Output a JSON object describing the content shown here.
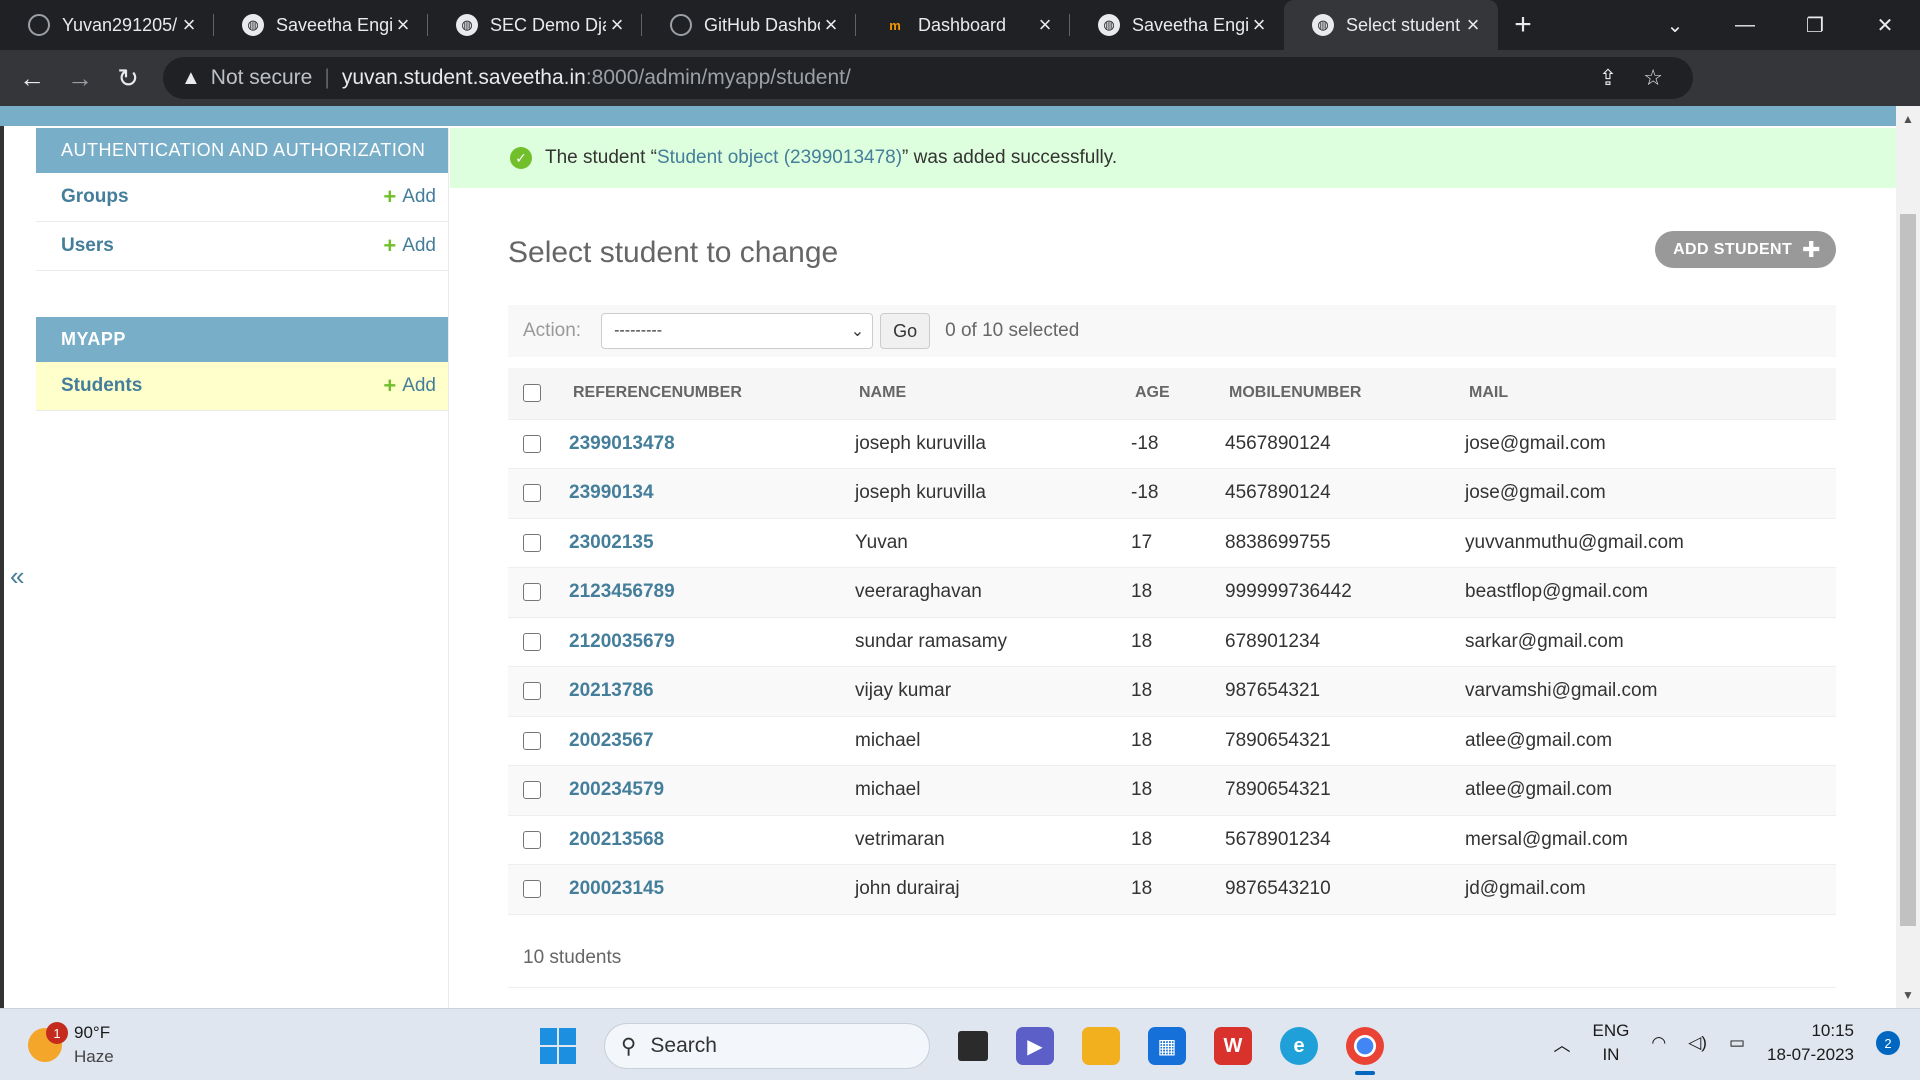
{
  "browser": {
    "tabs": [
      {
        "title": "Yuvan291205/",
        "icon": "github-icon"
      },
      {
        "title": "Saveetha Engin",
        "icon": "globe-icon"
      },
      {
        "title": "SEC Demo Djar",
        "icon": "globe-icon"
      },
      {
        "title": "GitHub Dashbo",
        "icon": "github-icon"
      },
      {
        "title": "Dashboard",
        "icon": "moodle-icon"
      },
      {
        "title": "Saveetha Engin",
        "icon": "globe-icon"
      },
      {
        "title": "Select student",
        "icon": "globe-icon"
      }
    ],
    "security_label": "Not secure",
    "url_host": "yuvan.student.saveetha.in",
    "url_path": ":8000/admin/myapp/student/"
  },
  "sidebar": {
    "auth_caption": "AUTHENTICATION AND AUTHORIZATION",
    "auth_models": [
      {
        "label": "Groups",
        "add": "Add"
      },
      {
        "label": "Users",
        "add": "Add"
      }
    ],
    "app_caption": "MYAPP",
    "app_models": [
      {
        "label": "Students",
        "add": "Add"
      }
    ],
    "collapse_glyph": "«"
  },
  "message": {
    "prefix": "The student “",
    "link": "Student object (2399013478)",
    "suffix": "” was added successfully."
  },
  "changelist": {
    "title": "Select student to change",
    "add_button": "ADD STUDENT",
    "action_label": "Action:",
    "action_selected": "---------",
    "go_label": "Go",
    "selected_counter": "0 of 10 selected",
    "columns": [
      "REFERENCENUMBER",
      "NAME",
      "AGE",
      "MOBILENUMBER",
      "MAIL"
    ],
    "rows": [
      {
        "ref": "2399013478",
        "name": "joseph kuruvilla",
        "age": "-18",
        "mobile": "4567890124",
        "mail": "jose@gmail.com"
      },
      {
        "ref": "23990134",
        "name": "joseph kuruvilla",
        "age": "-18",
        "mobile": "4567890124",
        "mail": "jose@gmail.com"
      },
      {
        "ref": "23002135",
        "name": "Yuvan",
        "age": "17",
        "mobile": "8838699755",
        "mail": "yuvvanmuthu@gmail.com"
      },
      {
        "ref": "2123456789",
        "name": "veeraraghavan",
        "age": "18",
        "mobile": "999999736442",
        "mail": "beastflop@gmail.com"
      },
      {
        "ref": "2120035679",
        "name": "sundar ramasamy",
        "age": "18",
        "mobile": "678901234",
        "mail": "sarkar@gmail.com"
      },
      {
        "ref": "20213786",
        "name": "vijay kumar",
        "age": "18",
        "mobile": "987654321",
        "mail": "varvamshi@gmail.com"
      },
      {
        "ref": "20023567",
        "name": "michael",
        "age": "18",
        "mobile": "7890654321",
        "mail": "atlee@gmail.com"
      },
      {
        "ref": "200234579",
        "name": "michael",
        "age": "18",
        "mobile": "7890654321",
        "mail": "atlee@gmail.com"
      },
      {
        "ref": "200213568",
        "name": "vetrimaran",
        "age": "18",
        "mobile": "5678901234",
        "mail": "mersal@gmail.com"
      },
      {
        "ref": "200023145",
        "name": "john durairaj",
        "age": "18",
        "mobile": "9876543210",
        "mail": "jd@gmail.com"
      }
    ],
    "paginator": "10 students"
  },
  "taskbar": {
    "weather_temp": "90°F",
    "weather_desc": "Haze",
    "weather_badge": "1",
    "search_placeholder": "Search",
    "lang_top": "ENG",
    "lang_bottom": "IN",
    "time": "10:15",
    "date": "18-07-2023",
    "notification_count": "2"
  },
  "colors": {
    "django_blue": "#79aec8",
    "link": "#447e9b",
    "add_green": "#70bf2b",
    "success_bg": "#ddffdd",
    "current_model_bg": "#ffffcc"
  }
}
